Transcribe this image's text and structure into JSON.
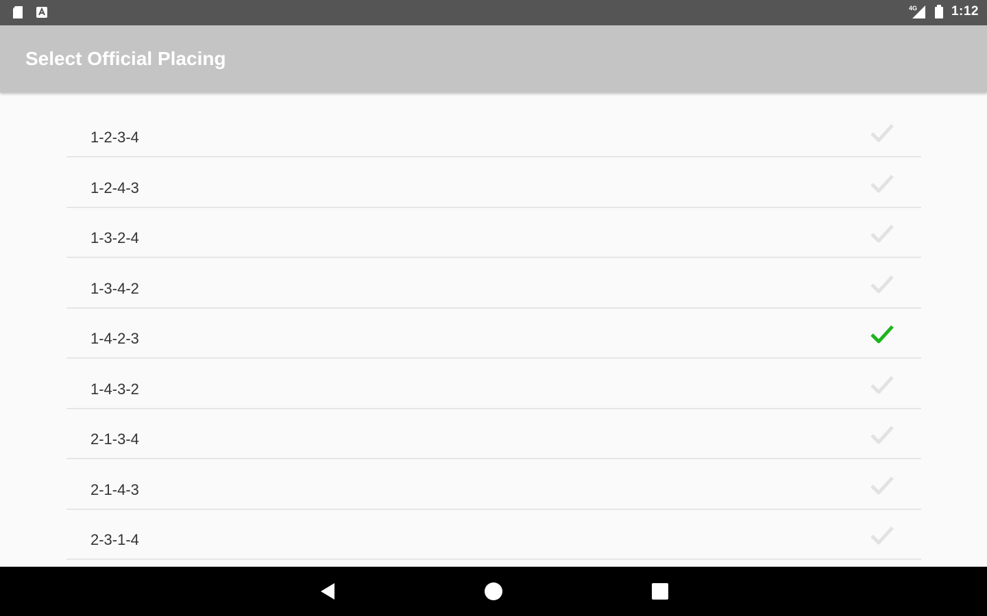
{
  "status_bar": {
    "left_icons": [
      "sd-card-icon",
      "notification-app-icon"
    ],
    "right_icons": [
      "signal-icon",
      "battery-icon"
    ],
    "time": "1:12"
  },
  "app_bar": {
    "title": "Select Official Placing"
  },
  "placings": [
    {
      "label": "1-2-3-4",
      "selected": false
    },
    {
      "label": "1-2-4-3",
      "selected": false
    },
    {
      "label": "1-3-2-4",
      "selected": false
    },
    {
      "label": "1-3-4-2",
      "selected": false
    },
    {
      "label": "1-4-2-3",
      "selected": true
    },
    {
      "label": "1-4-3-2",
      "selected": false
    },
    {
      "label": "2-1-3-4",
      "selected": false
    },
    {
      "label": "2-1-4-3",
      "selected": false
    },
    {
      "label": "2-3-1-4",
      "selected": false
    }
  ],
  "colors": {
    "check_selected": "#1db41d",
    "check_unselected": "#e2e2e2",
    "app_bar": "#c4c4c4",
    "status_bar": "#555555"
  },
  "nav_bar": {
    "buttons": [
      "back-icon",
      "home-icon",
      "recents-icon"
    ]
  }
}
